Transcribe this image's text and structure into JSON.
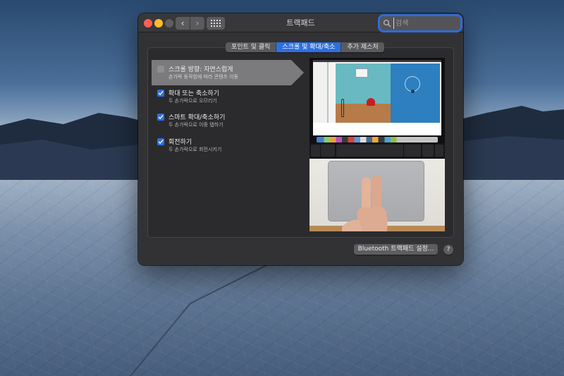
{
  "window": {
    "title": "트랙패드",
    "nav": {
      "back_icon": "‹",
      "forward_icon": "›"
    },
    "search": {
      "placeholder": "검색",
      "value": ""
    }
  },
  "tabs": [
    {
      "label": "포인트 및 클릭",
      "active": false
    },
    {
      "label": "스크롤 및 확대/축소",
      "active": true
    },
    {
      "label": "추가 제스처",
      "active": false
    }
  ],
  "options": [
    {
      "title": "스크롤 방향: 자연스럽게",
      "subtitle": "손가락 동작임에 따라 콘텐츠 이동",
      "checked": false,
      "selected": true
    },
    {
      "title": "확대 또는 축소하기",
      "subtitle": "두 손가락으로 오므리기",
      "checked": true,
      "selected": false
    },
    {
      "title": "스마트 확대/축소하기",
      "subtitle": "두 손가락으로 이중 탭하기",
      "checked": true,
      "selected": false
    },
    {
      "title": "회전하기",
      "subtitle": "두 손가락으로 회전시키기",
      "checked": true,
      "selected": false
    }
  ],
  "footer": {
    "bluetooth_button": "Bluetooth 트랙패드 설정...",
    "help_button": "?"
  },
  "colors": {
    "accent": "#2e6fe0",
    "close": "#ff5f57",
    "minimize": "#febc2e",
    "window_bg": "#323234"
  },
  "icons": {
    "search": "magnifier",
    "checkbox_checked": "checkmark",
    "grid": "show-all-grid"
  }
}
